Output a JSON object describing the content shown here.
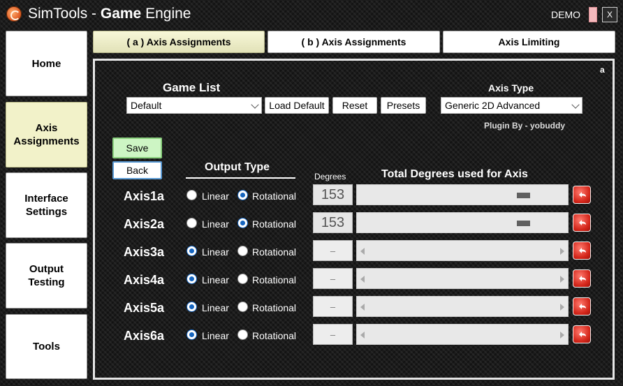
{
  "window": {
    "title_light": "Sim",
    "title_bold": "Tools",
    "title_sep": " - ",
    "title_bold2": "Game",
    "title_rest": " Engine",
    "demo_label": "DEMO",
    "close_label": "X",
    "demo_color": "#f4b9bd"
  },
  "sidebar": {
    "items": [
      {
        "label": "Home"
      },
      {
        "label": "Axis\nAssignments"
      },
      {
        "label": "Interface\nSettings"
      },
      {
        "label": "Output\nTesting"
      },
      {
        "label": "Tools"
      }
    ],
    "active": "Axis\nAssignments"
  },
  "tabs": [
    {
      "label": "( a ) Axis Assignments"
    },
    {
      "label": "( b ) Axis Assignments"
    },
    {
      "label": "Axis Limiting"
    }
  ],
  "panel": {
    "corner_label": "a",
    "game_list_label": "Game List",
    "game_list_value": "Default",
    "load_default_label": "Load Default",
    "reset_label": "Reset",
    "presets_label": "Presets",
    "axis_type_label": "Axis Type",
    "axis_type_value": "Generic 2D Advanced",
    "plugin_by": "Plugin By - yobuddy",
    "save_label": "Save",
    "back_label": "Back",
    "output_type_label": "Output Type",
    "degrees_label": "Degrees",
    "total_degrees_label": "Total Degrees used for Axis",
    "linear_label": "Linear",
    "rotational_label": "Rotational"
  },
  "axes": [
    {
      "name": "Axis1a",
      "output": "Rotational",
      "degrees": "153",
      "slider_fraction": 0.79
    },
    {
      "name": "Axis2a",
      "output": "Rotational",
      "degrees": "153",
      "slider_fraction": 0.79
    },
    {
      "name": "Axis3a",
      "output": "Linear",
      "degrees": "–",
      "slider_fraction": null
    },
    {
      "name": "Axis4a",
      "output": "Linear",
      "degrees": "–",
      "slider_fraction": null
    },
    {
      "name": "Axis5a",
      "output": "Linear",
      "degrees": "–",
      "slider_fraction": null
    },
    {
      "name": "Axis6a",
      "output": "Linear",
      "degrees": "–",
      "slider_fraction": null
    }
  ],
  "colors": {
    "accent_radio": "#1565c0",
    "save_bg": "#cdf5c4",
    "active_tab_bg": "#f2f2c9",
    "reset_icon": "#d4261a"
  },
  "icons": {
    "app_logo": "simtools-logo-icon",
    "row_reset": "undo-arrow-icon"
  }
}
